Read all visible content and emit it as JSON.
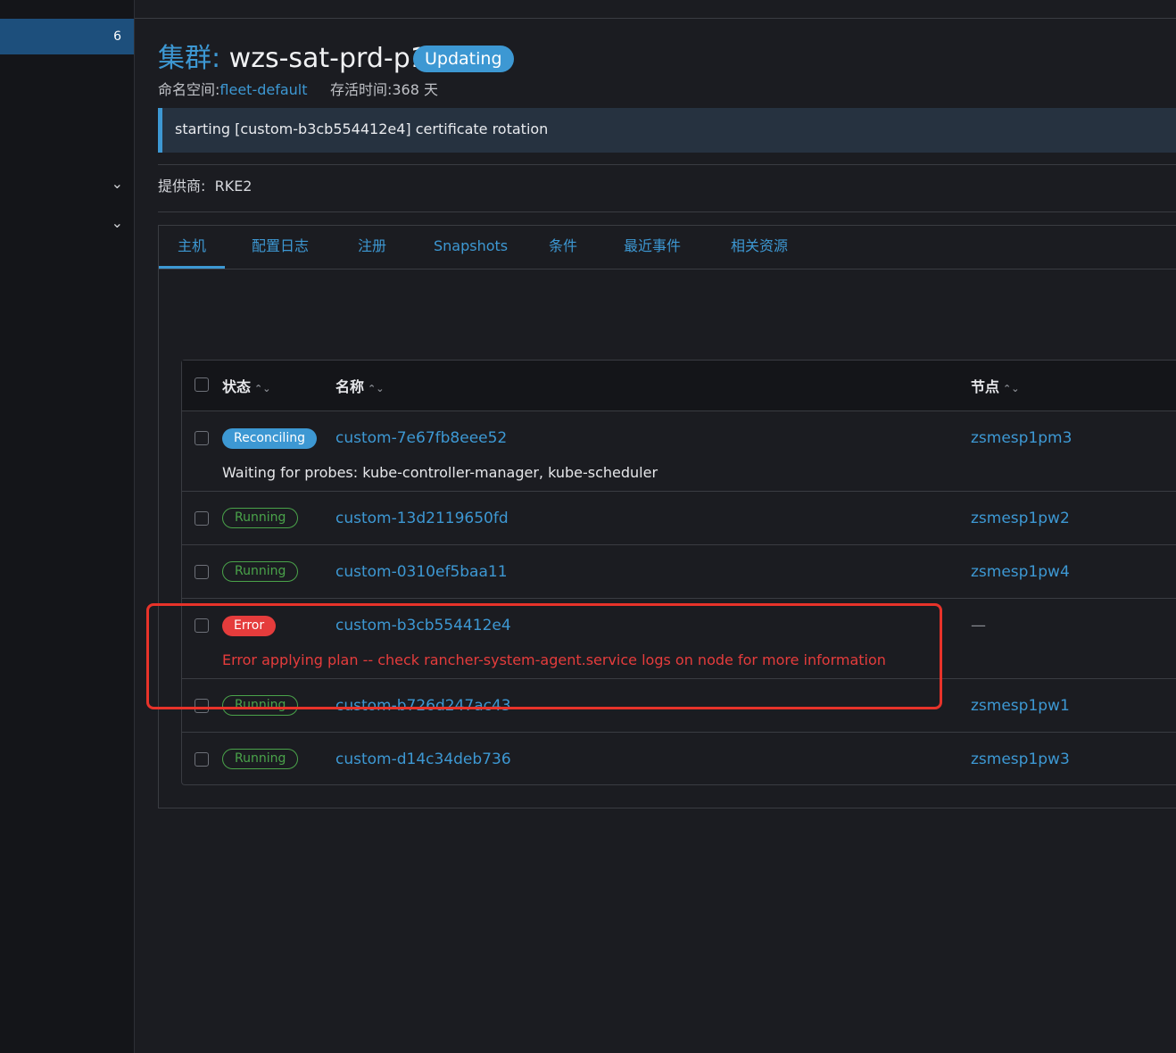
{
  "sidebar": {
    "active_badge": "6",
    "chevron": "⌄"
  },
  "header": {
    "title_prefix": "集群:",
    "title_name": "wzs-sat-prd-p1",
    "state": "Updating",
    "namespace_label": "命名空间:",
    "namespace_value": "fleet-default",
    "age_label": "存活时间:",
    "age_value": "368 天"
  },
  "banner": {
    "message": "starting [custom-b3cb554412e4] certificate rotation"
  },
  "provider": {
    "label": "提供商:",
    "value": "RKE2"
  },
  "tabs": [
    "主机",
    "配置日志",
    "注册",
    "Snapshots",
    "条件",
    "最近事件",
    "相关资源"
  ],
  "active_tab": "主机",
  "table": {
    "headers": {
      "state": "状态",
      "name": "名称",
      "node": "节点"
    },
    "sort_icon": "⌃⌄",
    "rows": [
      {
        "state": "Reconciling",
        "name": "custom-7e67fb8eee52",
        "node": "zsmesp1pm3",
        "subtext": "Waiting for probes: kube-controller-manager, kube-scheduler"
      },
      {
        "state": "Running",
        "name": "custom-13d2119650fd",
        "node": "zsmesp1pw2"
      },
      {
        "state": "Running",
        "name": "custom-0310ef5baa11",
        "node": "zsmesp1pw4"
      },
      {
        "state": "Error",
        "name": "custom-b3cb554412e4",
        "node": "—",
        "subtext": "Error applying plan -- check rancher-system-agent.service logs on node for more information"
      },
      {
        "state": "Running",
        "name": "custom-b726d247ac43",
        "node": "zsmesp1pw1"
      },
      {
        "state": "Running",
        "name": "custom-d14c34deb736",
        "node": "zsmesp1pw3"
      }
    ]
  },
  "colors": {
    "accent": "#3d98d3",
    "running": "#4aa34a",
    "error": "#e53c3c",
    "highlight": "#e8332a"
  }
}
